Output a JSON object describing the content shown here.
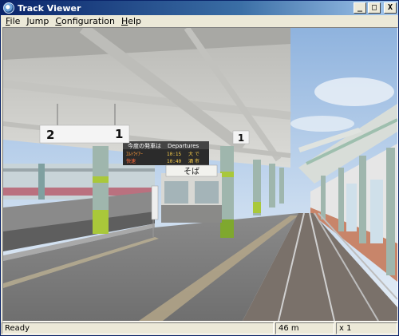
{
  "window": {
    "title": "Track Viewer"
  },
  "window_buttons": {
    "minimize": "_",
    "maximize": "□",
    "close": "X"
  },
  "menu": [
    {
      "key": "F",
      "rest": "ile"
    },
    {
      "key": "J",
      "rest": "ump"
    },
    {
      "key": "C",
      "rest": "onfiguration"
    },
    {
      "key": "H",
      "rest": "elp"
    }
  ],
  "scene": {
    "platform_sign_left": {
      "left": "2",
      "right": "1"
    },
    "platform_sign_right": "1",
    "departures_board": {
      "title_jp": "今度の発車は",
      "title_en": "Departures",
      "row1": {
        "type": "ｴﾙﾄﾗｲｱｰ",
        "time": "10:15",
        "dest": "大 で"
      },
      "row2": {
        "type": "快速",
        "time": "10:40",
        "dest": "酒 市"
      }
    },
    "shop_sign": "そば",
    "colors": {
      "sky": "#a9c5e6",
      "roof": "#d3d3cf",
      "pillar": "#9fb6ad",
      "pillar_band": "#a9c83a",
      "platform": "#7d7d7d",
      "rail": "#c9c9c9"
    }
  },
  "status": {
    "text": "Ready",
    "distance": "46 m",
    "speed": "x 1"
  }
}
